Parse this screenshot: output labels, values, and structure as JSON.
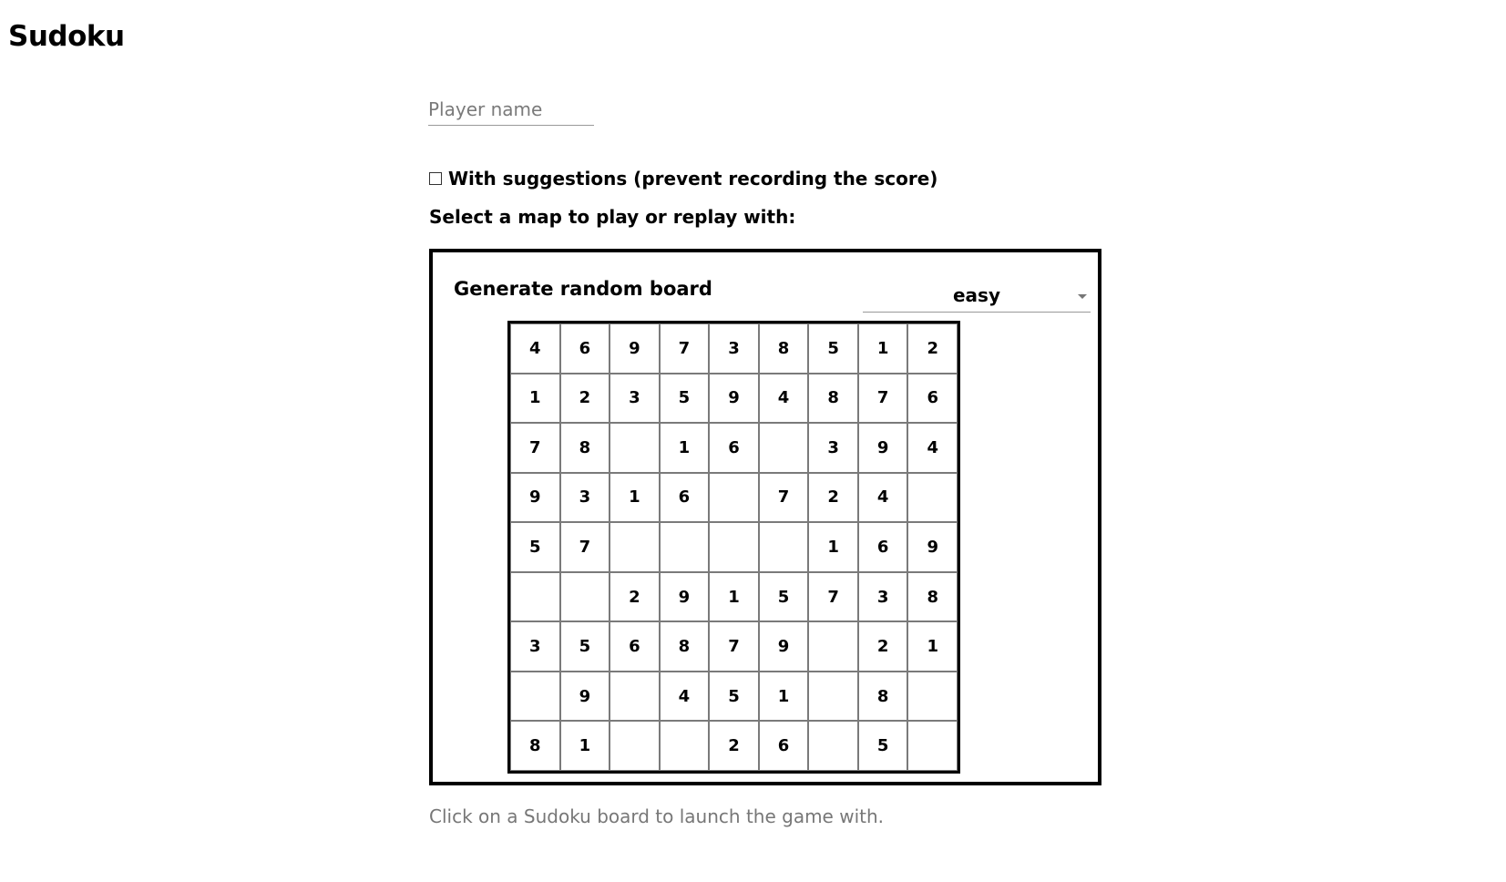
{
  "app": {
    "title": "Sudoku"
  },
  "player": {
    "placeholder": "Player name",
    "value": ""
  },
  "suggestions": {
    "label": "With suggestions (prevent recording the score)",
    "checked": false
  },
  "select_map": {
    "label": "Select a map to play or replay with:"
  },
  "board_panel": {
    "generate_label": "Generate random board",
    "difficulty": {
      "selected": "easy"
    },
    "grid": [
      [
        "4",
        "6",
        "9",
        "7",
        "3",
        "8",
        "5",
        "1",
        "2"
      ],
      [
        "1",
        "2",
        "3",
        "5",
        "9",
        "4",
        "8",
        "7",
        "6"
      ],
      [
        "7",
        "8",
        "",
        "1",
        "6",
        "",
        "3",
        "9",
        "4"
      ],
      [
        "9",
        "3",
        "1",
        "6",
        "",
        "7",
        "2",
        "4",
        ""
      ],
      [
        "5",
        "7",
        "",
        "",
        "",
        "",
        "1",
        "6",
        "9"
      ],
      [
        "",
        "",
        "2",
        "9",
        "1",
        "5",
        "7",
        "3",
        "8"
      ],
      [
        "3",
        "5",
        "6",
        "8",
        "7",
        "9",
        "",
        "2",
        "1"
      ],
      [
        "",
        "9",
        "",
        "4",
        "5",
        "1",
        "",
        "8",
        ""
      ],
      [
        "8",
        "1",
        "",
        "",
        "2",
        "6",
        "",
        "5",
        ""
      ]
    ]
  },
  "hint": {
    "text": "Click on a Sudoku board to launch the game with."
  }
}
